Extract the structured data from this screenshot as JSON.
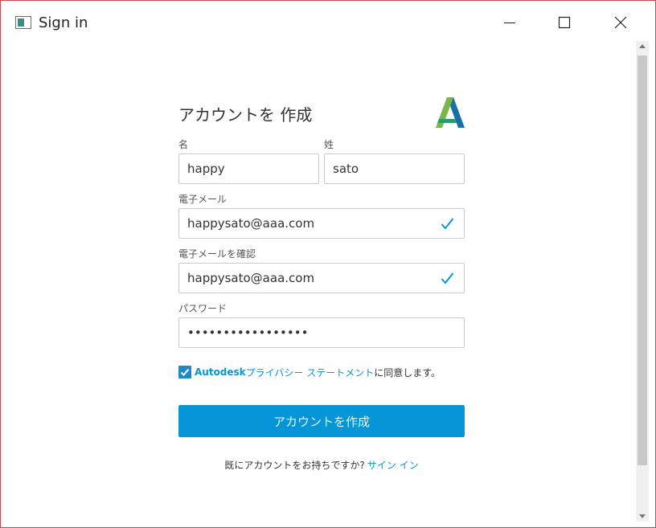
{
  "window": {
    "title": "Sign in"
  },
  "form": {
    "heading": "アカウントを 作成",
    "first_name": {
      "label": "名",
      "value": "happy"
    },
    "last_name": {
      "label": "姓",
      "value": "sato"
    },
    "email": {
      "label": "電子メール",
      "value": "happysato@aaa.com"
    },
    "email_confirm": {
      "label": "電子メールを確認",
      "value": "happysato@aaa.com"
    },
    "password": {
      "label": "パスワード",
      "value": "•••••••••••••••••"
    },
    "agree": {
      "brand": "Autodesk",
      "link": "プライバシー ステートメント",
      "suffix": "に同意します。",
      "checked": true
    },
    "submit_label": "アカウントを作成",
    "signin_prompt": "既にアカウントをお持ちですか?",
    "signin_link": "サイン イン"
  },
  "colors": {
    "accent": "#0696d7",
    "border": "#c94a4a",
    "checkbox": "#1f8ac5"
  }
}
